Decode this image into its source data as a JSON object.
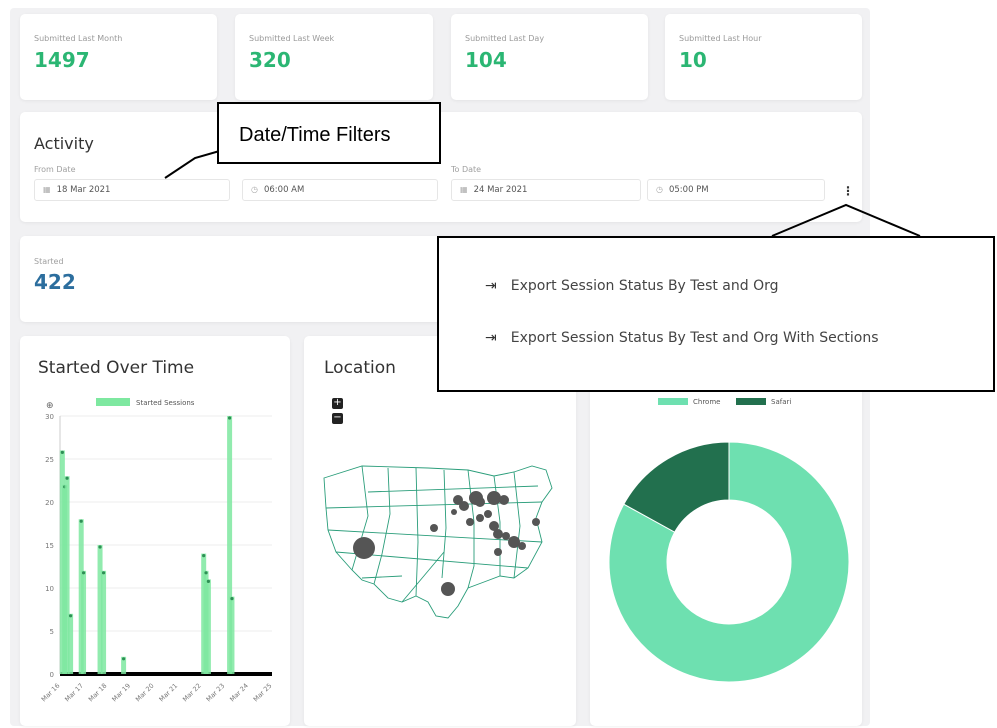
{
  "stats": [
    {
      "label": "Submitted Last Month",
      "value": "1497"
    },
    {
      "label": "Submitted Last Week",
      "value": "320"
    },
    {
      "label": "Submitted Last Day",
      "value": "104"
    },
    {
      "label": "Submitted Last Hour",
      "value": "10"
    }
  ],
  "activity": {
    "title": "Activity",
    "from_label": "From Date",
    "from_date": "18 Mar 2021",
    "from_time": "06:00 AM",
    "to_label": "To Date",
    "to_date": "24 Mar 2021",
    "to_time": "05:00 PM"
  },
  "started": {
    "label": "Started",
    "value": "422"
  },
  "callout": {
    "text": "Date/Time Filters"
  },
  "menu": {
    "items": [
      {
        "label": "Export Session Status By Test and Org"
      },
      {
        "label": "Export Session Status By Test and Org With Sections"
      }
    ]
  },
  "panels": {
    "started_over_time": "Started Over Time",
    "location": "Location"
  },
  "colors": {
    "accent": "#2bb673",
    "bar": "#7ee8a0",
    "chrome": "#6ee0b0",
    "safari": "#22704e",
    "started": "#2c6e9e"
  },
  "chart_data": [
    {
      "type": "bar",
      "title": "Started Over Time",
      "legend": [
        "Started Sessions"
      ],
      "x_ticks": [
        "Mar 16",
        "Mar 17",
        "Mar 18",
        "Mar 19",
        "Mar 20",
        "Mar 21",
        "Mar 22",
        "Mar 23",
        "Mar 24",
        "Mar 25"
      ],
      "y_ticks": [
        "0",
        "5",
        "10",
        "15",
        "20",
        "25",
        "30"
      ],
      "ylim": [
        0,
        30
      ],
      "series": [
        {
          "name": "Started Sessions",
          "x": [
            0.1,
            0.2,
            0.3,
            0.45,
            0.9,
            1.0,
            1.7,
            1.85,
            2.7,
            6.1,
            6.2,
            6.3,
            7.2,
            7.3
          ],
          "values": [
            26,
            22,
            23,
            7,
            18,
            12,
            15,
            12,
            2,
            14,
            12,
            11,
            30,
            9
          ]
        }
      ]
    },
    {
      "type": "pie",
      "legend": [
        "Chrome",
        "Safari"
      ],
      "series": [
        {
          "name": "Browser",
          "labels": [
            "Chrome",
            "Safari"
          ],
          "values": [
            83,
            17
          ]
        }
      ]
    }
  ]
}
